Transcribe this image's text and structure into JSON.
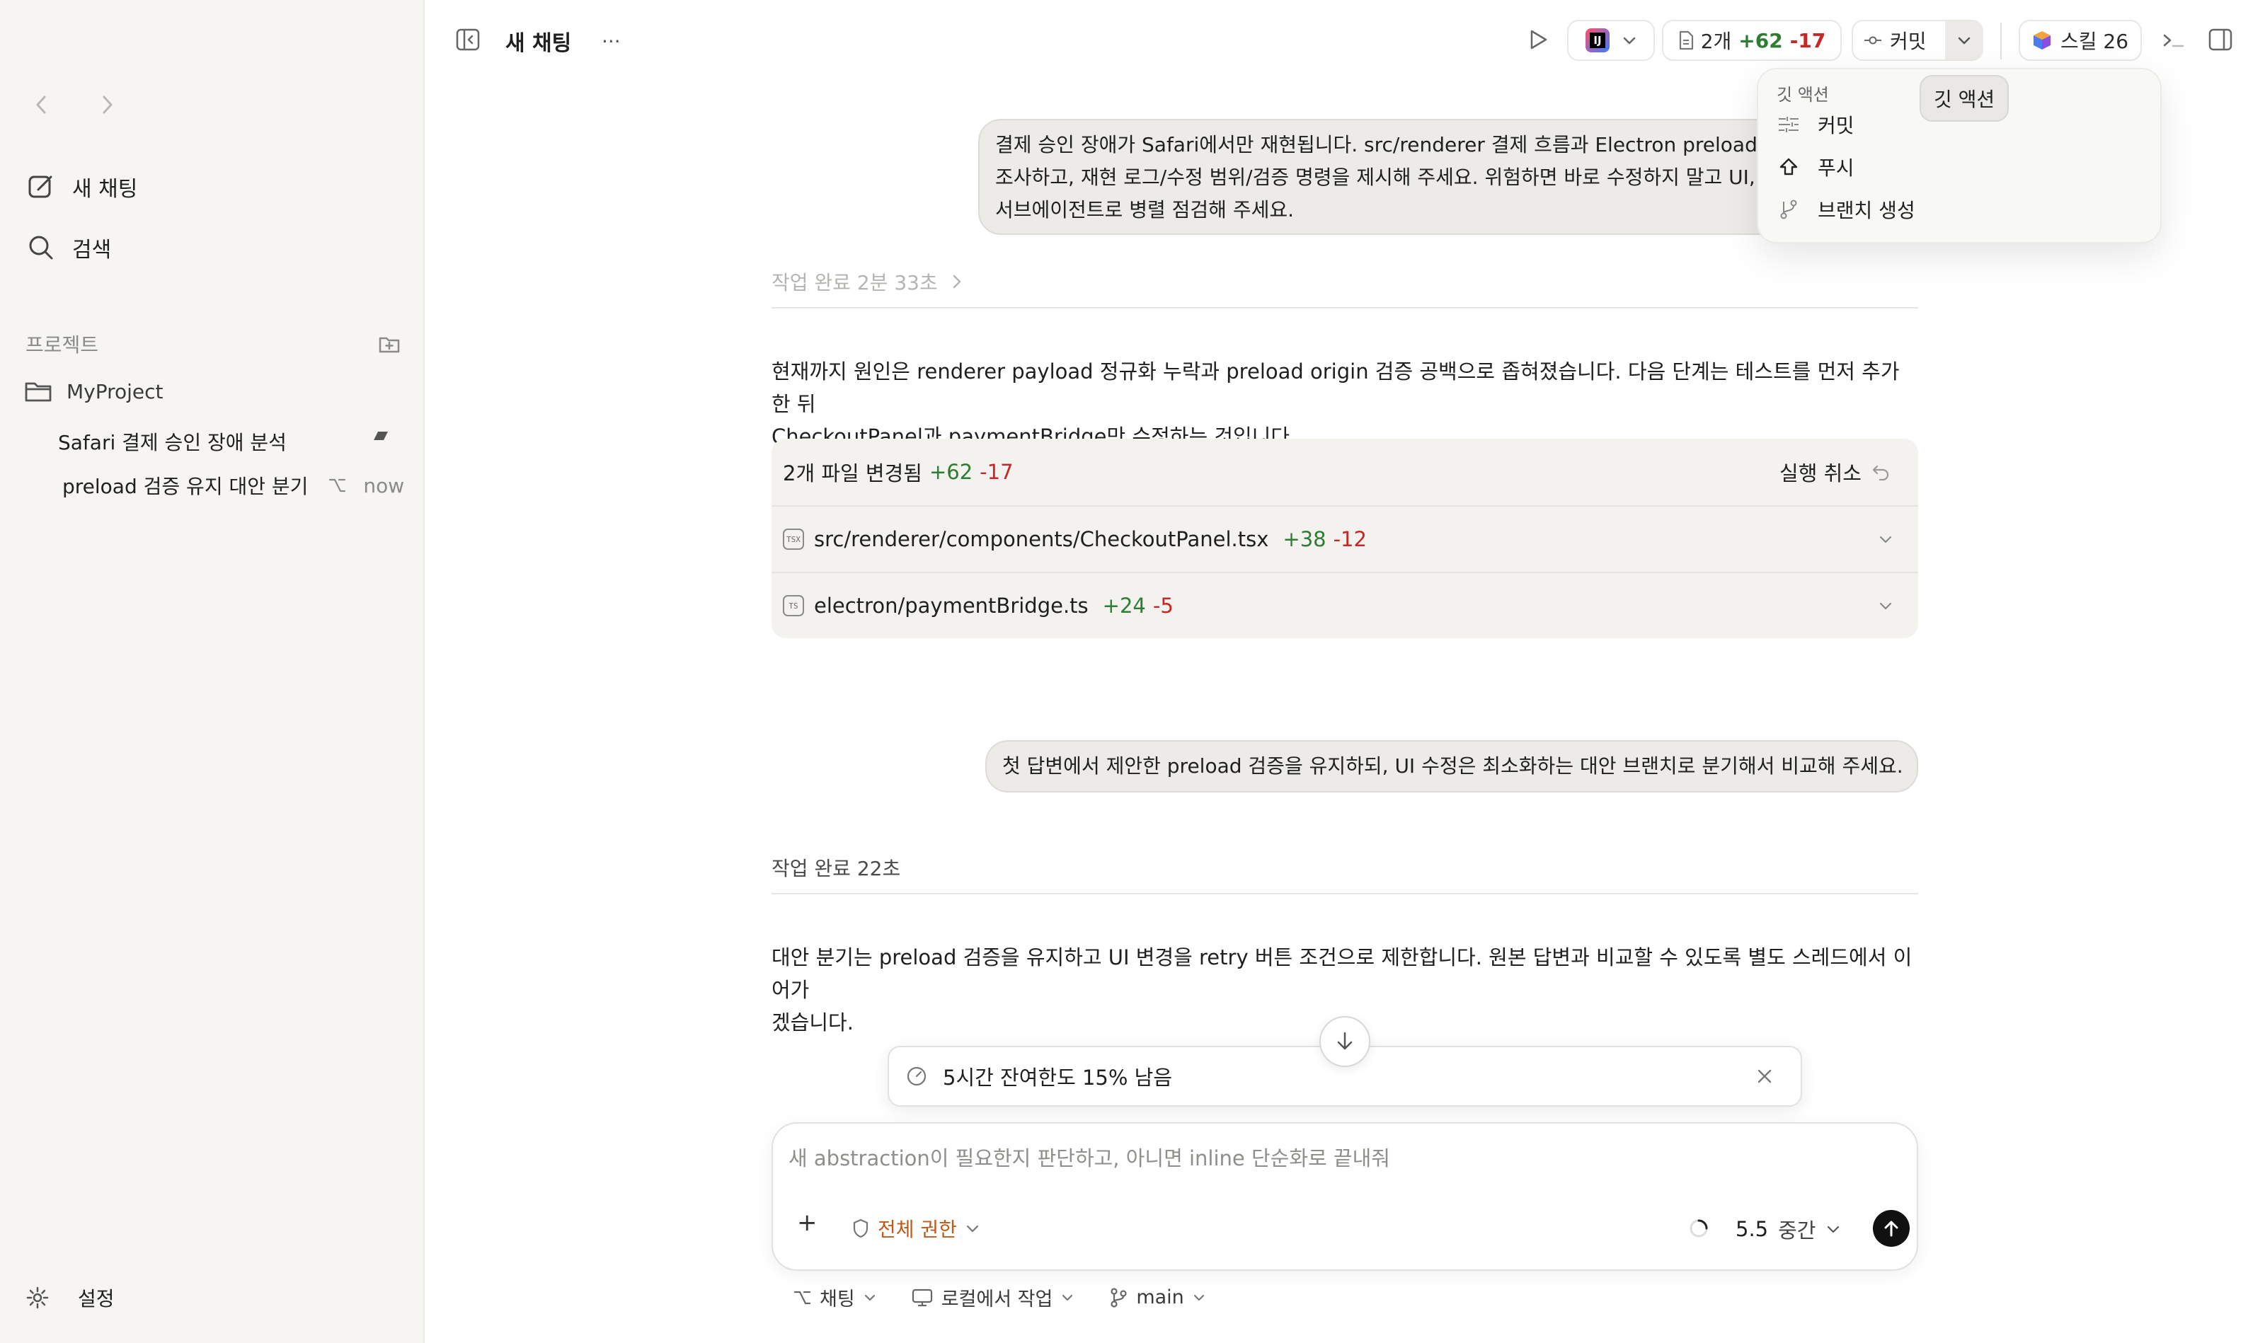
{
  "sidebar": {
    "new_chat_label": "새 채팅",
    "search_label": "검색",
    "projects_label": "프로젝트",
    "project_name": "MyProject",
    "threads": [
      {
        "label": "Safari 결제 승인 장애 분석",
        "time": ""
      },
      {
        "label": "preload 검증 유지 대안 분기",
        "time": "now"
      }
    ],
    "settings_label": "설정"
  },
  "topbar": {
    "title": "새 채팅",
    "more": "...",
    "ide_badge": "IJ",
    "diff_count": "2개",
    "diff_plus": "+62",
    "diff_minus": "-17",
    "commit_label": "커밋",
    "skills_label": "스킬 26"
  },
  "git_menu": {
    "header": "깃 액션",
    "tooltip": "깃 액션",
    "items": [
      {
        "label": "커밋",
        "icon": "commit-icon"
      },
      {
        "label": "푸시",
        "icon": "push-icon"
      },
      {
        "label": "브랜치 생성",
        "icon": "branch-icon"
      }
    ]
  },
  "messages": {
    "user1_lines": [
      "결제 승인 장애가 Safari에서만 재현됩니다. src/renderer 결제 흐름과 Electron preload l",
      "조사하고, 재현 로그/수정 범위/검증 명령을 제시해 주세요. 위험하면 바로 수정하지 말고 UI,",
      "서브에이전트로 병렬 점검해 주세요."
    ],
    "status1": "작업 완료 2분 33초",
    "reply1_lines": [
      "현재까지 원인은 renderer payload 정규화 누락과 preload origin 검증 공백으로 좁혀졌습니다. 다음 단계는 테스트를 먼저 추가한 뒤",
      "CheckoutPanel과 paymentBridge만 수정하는 것입니다."
    ],
    "changes": {
      "title": "2개 파일 변경됨",
      "plus": "+62",
      "minus": "-17",
      "undo_label": "실행 취소",
      "files": [
        {
          "badge": "TSX",
          "path": "src/renderer/components/CheckoutPanel.tsx",
          "plus": "+38",
          "minus": "-12"
        },
        {
          "badge": "TS",
          "path": "electron/paymentBridge.ts",
          "plus": "+24",
          "minus": "-5"
        }
      ]
    },
    "user2": "첫 답변에서 제안한 preload 검증을 유지하되, UI 수정은 최소화하는 대안 브랜치로 분기해서 비교해 주세요.",
    "status2": "작업 완료 22초",
    "reply2_lines": [
      "대안 분기는 preload 검증을 유지하고 UI 변경을 retry 버튼 조건으로 제한합니다. 원본 답변과 비교할 수 있도록 별도 스레드에서 이어가",
      "겠습니다."
    ]
  },
  "rate_limit": {
    "text": "5시간 잔여한도 15% 남음"
  },
  "composer": {
    "placeholder": "새 abstraction이 필요한지 판단하고, 아니면 inline 단순화로 끝내줘",
    "add": "+",
    "permission": "전체 권한",
    "model": "5.5",
    "effort": "중간"
  },
  "footer": {
    "mode": "채팅",
    "env": "로컬에서 작업",
    "branch": "main"
  },
  "colors": {
    "added": "#2e7d32",
    "removed": "#c62828",
    "permission": "#c05a1a",
    "sidebar_bg": "#f6f5f2",
    "bubble_bg": "#ecebe8"
  }
}
